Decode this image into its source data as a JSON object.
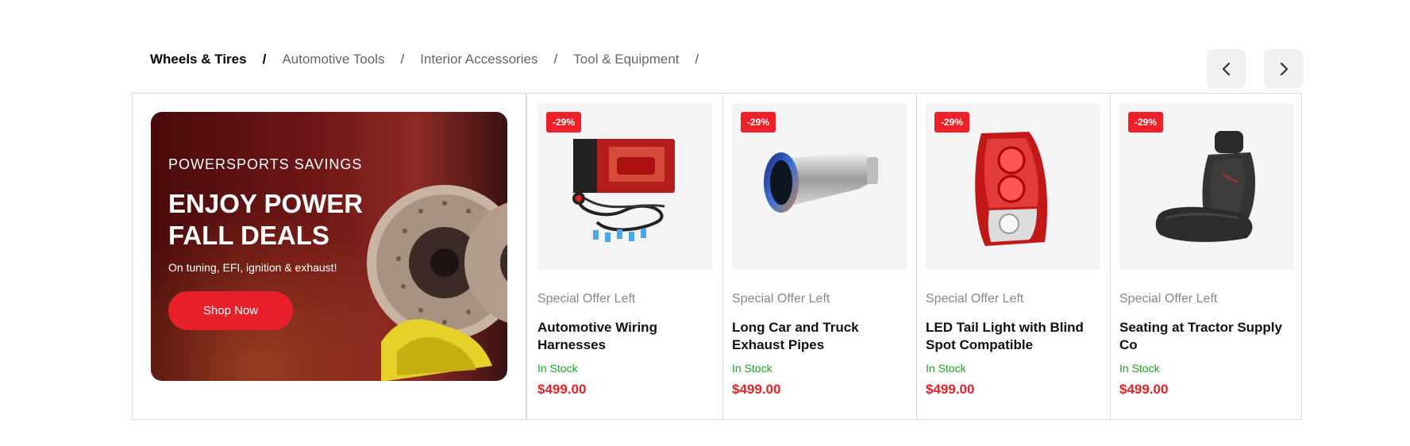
{
  "tabs": [
    {
      "label": "Wheels & Tires",
      "active": true
    },
    {
      "label": "Automotive Tools",
      "active": false
    },
    {
      "label": "Interior Accessories",
      "active": false
    },
    {
      "label": "Tool & Equipment",
      "active": false
    }
  ],
  "separator": "/",
  "nav": {
    "prev_icon": "chevron-left-icon",
    "next_icon": "chevron-right-icon"
  },
  "banner": {
    "eyebrow": "POWERSPORTS SAVINGS",
    "title_line1": "ENJOY POWER",
    "title_line2": "FALL DEALS",
    "subtitle": "On tuning, EFI, ignition & exhaust!",
    "button": "Shop Now"
  },
  "products": [
    {
      "badge": "-29%",
      "offer": "Special Offer Left",
      "name": "Automotive Wiring Harnesses",
      "stock": "In Stock",
      "price": "$499.00",
      "image": "wiring-harness-image"
    },
    {
      "badge": "-29%",
      "offer": "Special Offer Left",
      "name": "Long Car and Truck Exhaust Pipes",
      "stock": "In Stock",
      "price": "$499.00",
      "image": "exhaust-tip-image"
    },
    {
      "badge": "-29%",
      "offer": "Special Offer Left",
      "name": "LED Tail Light with Blind Spot Compatible",
      "stock": "In Stock",
      "price": "$499.00",
      "image": "tail-light-image"
    },
    {
      "badge": "-29%",
      "offer": "Special Offer Left",
      "name": "Seating at Tractor Supply Co",
      "stock": "In Stock",
      "price": "$499.00",
      "image": "car-seat-image"
    }
  ],
  "colors": {
    "accent": "#e8202a",
    "stock": "#1aa61a",
    "muted": "#888888"
  }
}
